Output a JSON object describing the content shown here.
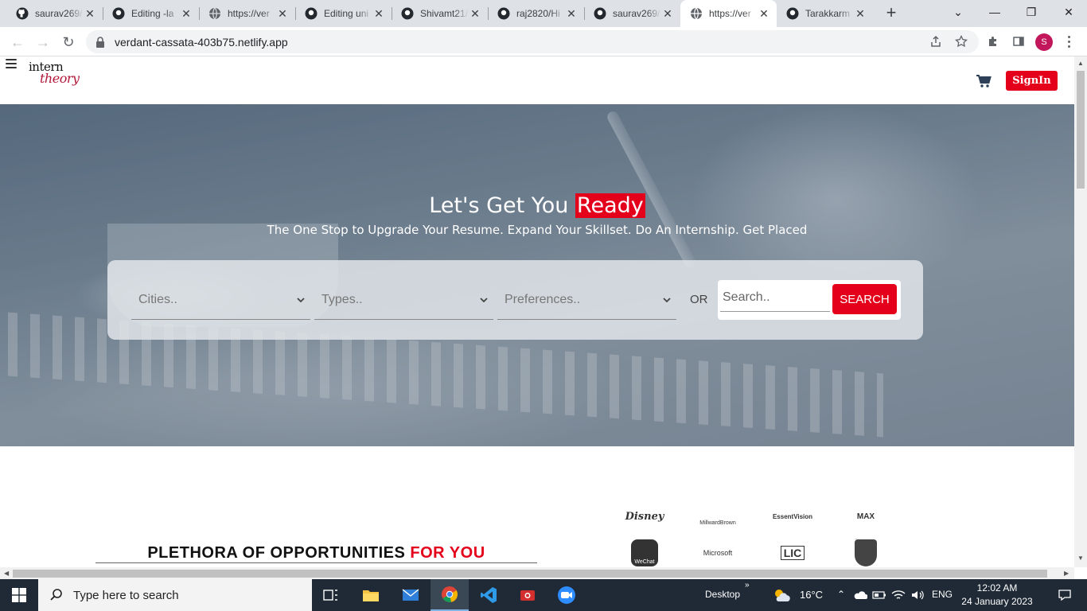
{
  "browser": {
    "tabs": [
      {
        "title": "saurav269/",
        "icon": "github-icon",
        "active": false
      },
      {
        "title": "Editing -la",
        "icon": "github-icon",
        "active": false
      },
      {
        "title": "https://ver",
        "icon": "globe-icon",
        "active": false
      },
      {
        "title": "Editing uni",
        "icon": "github-icon",
        "active": false
      },
      {
        "title": "Shivamt21/",
        "icon": "github-icon",
        "active": false
      },
      {
        "title": "raj2820/Hi",
        "icon": "github-icon",
        "active": false
      },
      {
        "title": "saurav269/",
        "icon": "github-icon",
        "active": false
      },
      {
        "title": "https://ver",
        "icon": "globe-icon",
        "active": true
      },
      {
        "title": "Tarakkarm",
        "icon": "github-icon",
        "active": false
      }
    ],
    "url": "verdant-cassata-403b75.netlify.app",
    "profile_initial": "S"
  },
  "site": {
    "logo_line1": "intern",
    "logo_line2": "theory",
    "signin_label": "SignIn",
    "hero": {
      "title_prefix": "Let's Get You ",
      "title_highlight": "Ready",
      "subtitle": "The One Stop to Upgrade Your Resume. Expand Your Skillset. Do An Internship. Get Placed"
    },
    "filters": {
      "cities_placeholder": "Cities..",
      "types_placeholder": "Types..",
      "preferences_placeholder": "Preferences..",
      "or_label": "OR",
      "search_placeholder": "Search..",
      "search_button": "SEARCH"
    },
    "section": {
      "title_main": "PLETHORA OF OPPORTUNITIES ",
      "title_highlight": "FOR YOU"
    },
    "partner_logos": [
      "Disney",
      "MillwardBrown",
      "EssentVision",
      "MAX",
      "WeChat",
      "Microsoft",
      "LIC",
      "Porsche"
    ],
    "accent_color": "#e4001b"
  },
  "taskbar": {
    "search_placeholder": "Type here to search",
    "desktop_label": "Desktop",
    "temperature": "16°C",
    "language": "ENG",
    "time": "12:02 AM",
    "date": "24 January 2023"
  }
}
